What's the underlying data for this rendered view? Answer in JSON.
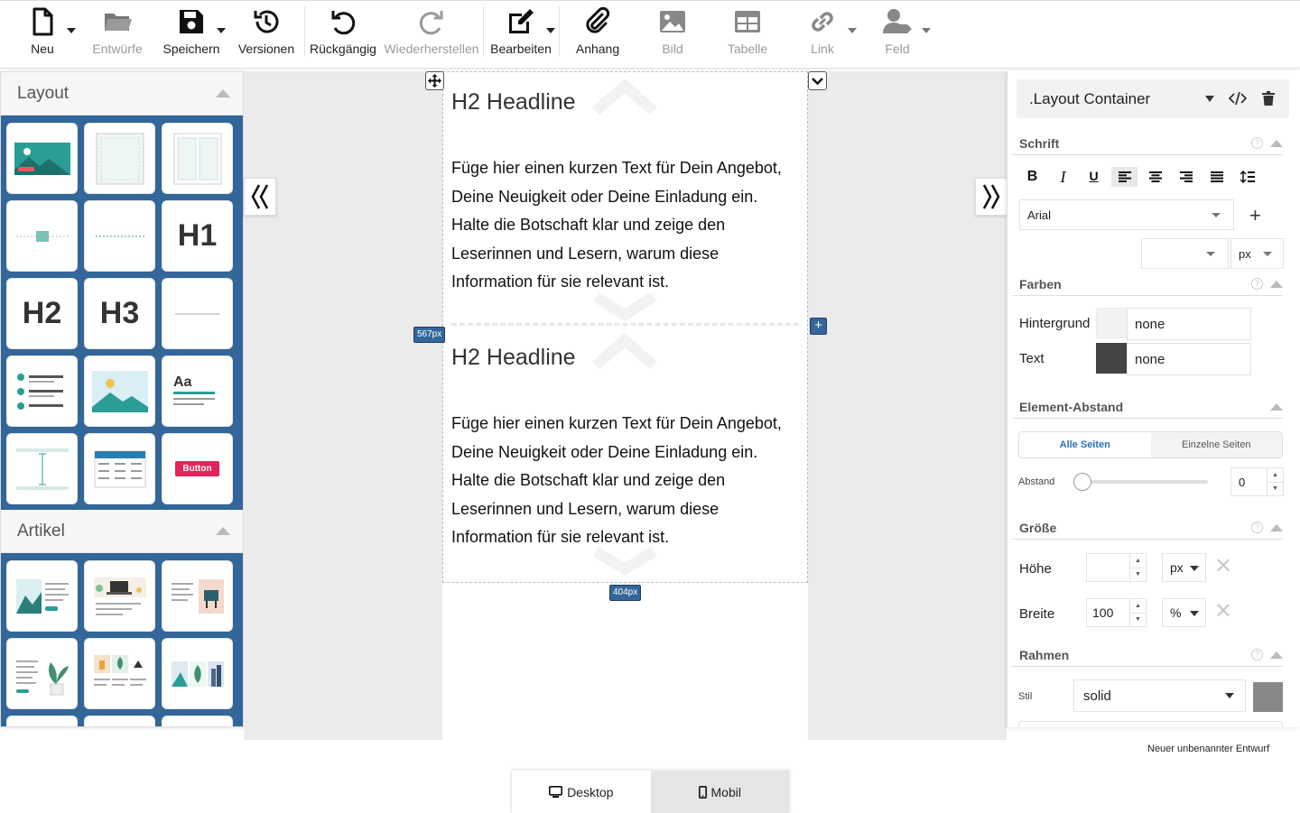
{
  "toolbar": {
    "new": "Neu",
    "drafts": "Entwürfe",
    "save": "Speichern",
    "versions": "Versionen",
    "undo": "Rückgängig",
    "redo": "Wiederherstellen",
    "edit": "Bearbeiten",
    "attachment": "Anhang",
    "image": "Bild",
    "table": "Tabelle",
    "link": "Link",
    "field": "Feld"
  },
  "left_panel": {
    "layout_title": "Layout",
    "articles_title": "Artikel",
    "tiles": {
      "h1": "H1",
      "h2": "H2",
      "h3": "H3",
      "text": "Aa",
      "button": "Button"
    }
  },
  "canvas": {
    "blocks": [
      {
        "headline": "H2 Headline",
        "body": "Füge hier einen kurzen Text für Dein Angebot, Deine Neuigkeit oder Deine Einladung ein. Halte die Botschaft klar und zeige den Leserinnen und Lesern, warum diese Information für sie relevant ist."
      },
      {
        "headline": "H2 Headline",
        "body": "Füge hier einen kurzen Text für Dein Angebot, Deine Neuigkeit oder Deine Einladung ein. Halte die Botschaft klar und zeige den Leserinnen und Lesern, warum diese Information für sie relevant ist."
      }
    ],
    "height_badge": "567px",
    "width_badge": "404px",
    "add_symbol": "+"
  },
  "right_panel": {
    "element_select": ".Layout Container",
    "font": {
      "title": "Schrift",
      "family": "Arial",
      "size": "",
      "unit": "px"
    },
    "colors": {
      "title": "Farben",
      "background_label": "Hintergrund",
      "background_value": "none",
      "background_swatch": "#f2f2f2",
      "text_label": "Text",
      "text_value": "none",
      "text_swatch": "#444444"
    },
    "spacing": {
      "title": "Element-Abstand",
      "tab_all": "Alle Seiten",
      "tab_single": "Einzelne Seiten",
      "label": "Abstand",
      "value": "0"
    },
    "size": {
      "title": "Größe",
      "height_label": "Höhe",
      "height_value": "",
      "height_unit": "px",
      "width_label": "Breite",
      "width_value": "100",
      "width_unit": "%"
    },
    "border": {
      "title": "Rahmen",
      "style_label": "Stil",
      "style_value": "solid",
      "swatch": "#888888"
    }
  },
  "footer": {
    "draft_name": "Neuer unbenannter Entwurf",
    "desktop": "Desktop",
    "mobile": "Mobil"
  },
  "colors": {
    "accent": "#336699",
    "teal": "#2aa198",
    "button_red": "#e2245a"
  }
}
